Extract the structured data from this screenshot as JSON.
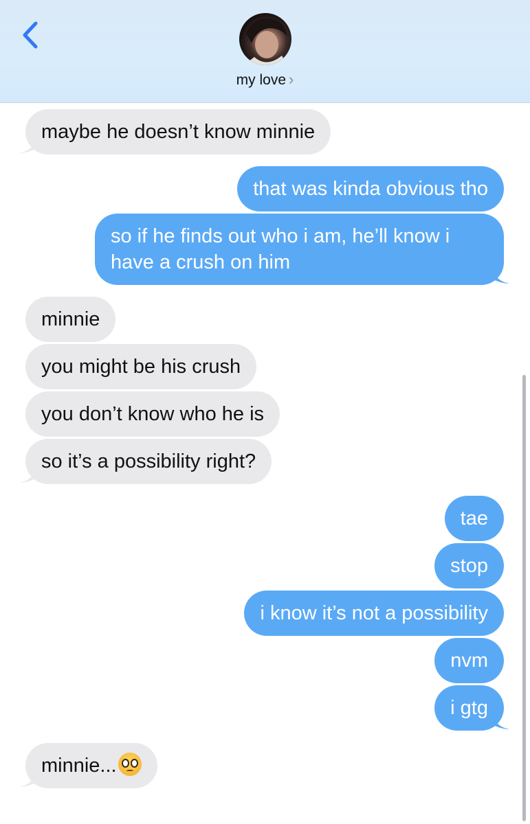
{
  "header": {
    "contact_name": "my love",
    "chevron": "›",
    "back_icon": "chevron-left-icon",
    "accent": "#3478f6"
  },
  "colors": {
    "incoming_bubble": "#e9e9eb",
    "outgoing_bubble": "#5aa9f5",
    "header_bg": "#d8ecfb"
  },
  "messages": [
    {
      "direction": "in",
      "text": "maybe he doesn’t know minnie"
    },
    {
      "direction": "out",
      "text": "that was kinda obvious tho"
    },
    {
      "direction": "out",
      "text": "so if he finds out who i am, he’ll know i have a crush on him"
    },
    {
      "direction": "in",
      "text": "minnie"
    },
    {
      "direction": "in",
      "text": "you might be his crush"
    },
    {
      "direction": "in",
      "text": "you don’t know who he is"
    },
    {
      "direction": "in",
      "text": "so it’s a possibility right?"
    },
    {
      "direction": "out",
      "text": "tae"
    },
    {
      "direction": "out",
      "text": "stop"
    },
    {
      "direction": "out",
      "text": "i know it’s not a possibility"
    },
    {
      "direction": "out",
      "text": "nvm"
    },
    {
      "direction": "out",
      "text": "i gtg"
    },
    {
      "direction": "in",
      "text": "minnie...",
      "emoji": "pleading-face-emoji"
    }
  ]
}
